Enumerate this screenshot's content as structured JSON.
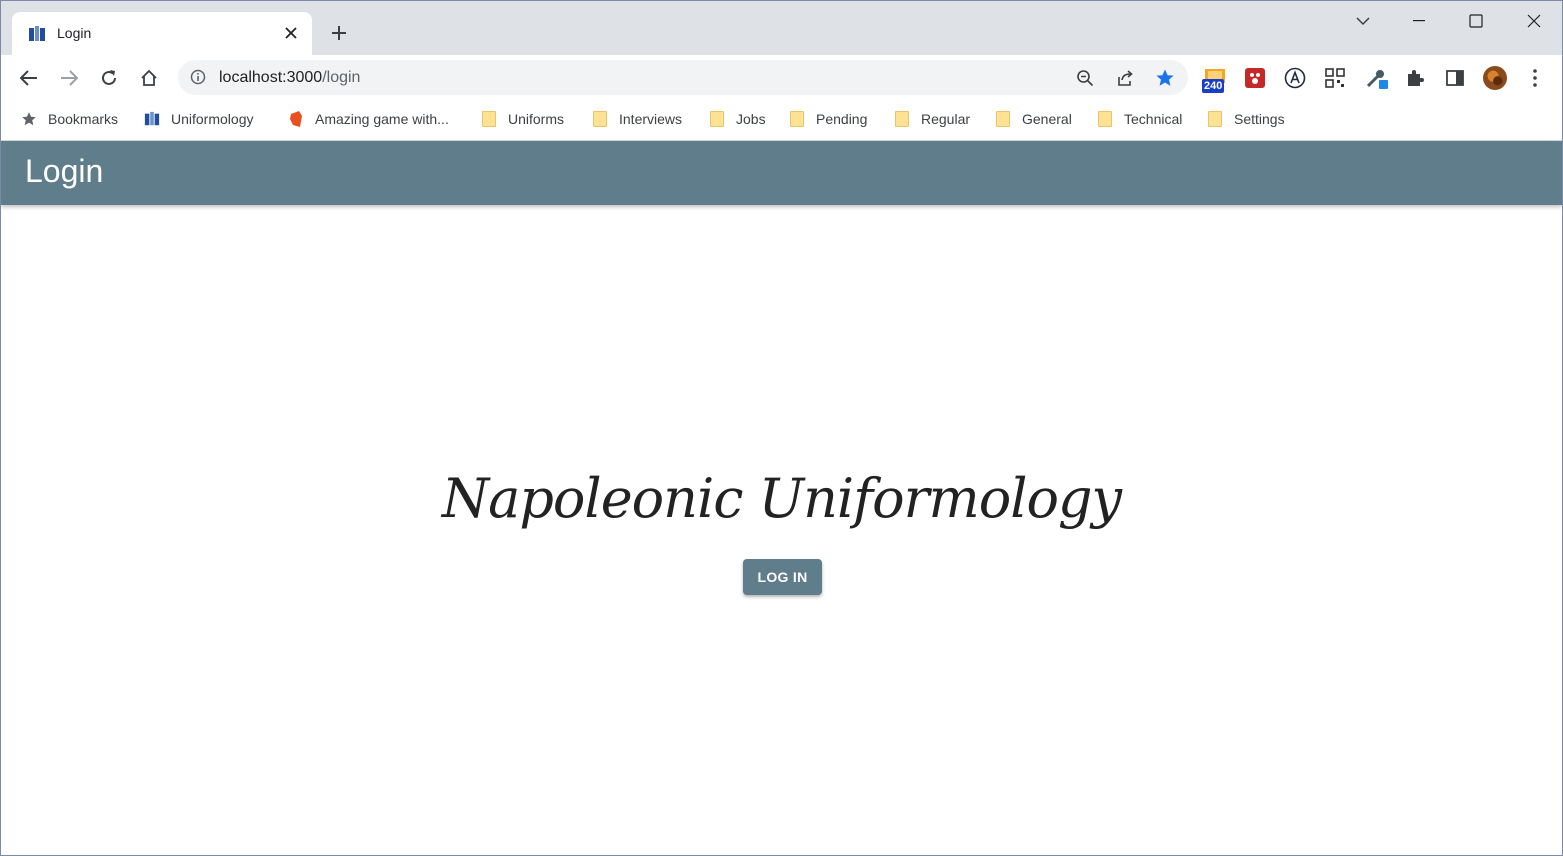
{
  "browser": {
    "tab": {
      "title": "Login",
      "favicon": "uniformology-favicon"
    },
    "omnibox": {
      "host": "localhost:3000",
      "path": "/login"
    },
    "extensions": {
      "badge_count": "240"
    },
    "bookmarks": [
      {
        "label": "Bookmarks",
        "icon": "star-icon"
      },
      {
        "label": "Uniformology",
        "icon": "uniformology-icon"
      },
      {
        "label": "Amazing game with...",
        "icon": "game-icon"
      },
      {
        "label": "Uniforms",
        "icon": "folder-icon"
      },
      {
        "label": "Interviews",
        "icon": "folder-icon"
      },
      {
        "label": "Jobs",
        "icon": "folder-icon"
      },
      {
        "label": "Pending",
        "icon": "folder-icon"
      },
      {
        "label": "Regular",
        "icon": "folder-icon"
      },
      {
        "label": "General",
        "icon": "folder-icon"
      },
      {
        "label": "Technical",
        "icon": "folder-icon"
      },
      {
        "label": "Settings",
        "icon": "folder-icon"
      }
    ]
  },
  "app": {
    "header_title": "Login",
    "brand_title": "Napoleonic Uniformology",
    "login_button": "LOG IN",
    "colors": {
      "primary": "#607d8b",
      "star_active": "#1a73e8"
    }
  }
}
